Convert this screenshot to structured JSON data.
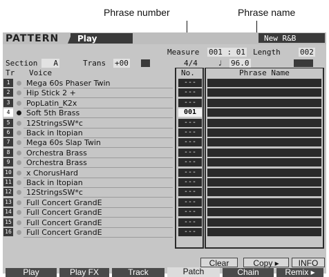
{
  "callouts": {
    "phrase_number": "Phrase number",
    "phrase_name": "Phrase name"
  },
  "header": {
    "mode": "PATTERN",
    "screen": "Play",
    "song_name": "New R&B"
  },
  "measure": {
    "label": "Measure",
    "value": "001 : 01",
    "length_label": "Length",
    "length_value": "002"
  },
  "section_bar": {
    "section_label": "Section",
    "section_value": "A",
    "trans_label": "Trans",
    "trans_value": "+00",
    "meter": "4/4",
    "tempo_symbol": "♩",
    "tempo": "96.0"
  },
  "columns": {
    "track": "Tr",
    "voice": "Voice",
    "number": "No.",
    "phrase_name": "Phrase Name"
  },
  "tracks": [
    {
      "tr": "1",
      "voice": "Mega 60s Phaser Twin",
      "no": "---"
    },
    {
      "tr": "2",
      "voice": "Hip Stick 2 +",
      "no": "---"
    },
    {
      "tr": "3",
      "voice": "PopLatin_K2x",
      "no": "---"
    },
    {
      "tr": "4",
      "voice": "Soft 5th Brass",
      "no": "001"
    },
    {
      "tr": "5",
      "voice": "12StringsSW*c",
      "no": "---"
    },
    {
      "tr": "6",
      "voice": "Back in Itopian",
      "no": "---"
    },
    {
      "tr": "7",
      "voice": "Mega 60s Slap Twin",
      "no": "---"
    },
    {
      "tr": "8",
      "voice": "Orchestra Brass",
      "no": "---"
    },
    {
      "tr": "9",
      "voice": "Orchestra Brass",
      "no": "---"
    },
    {
      "tr": "10",
      "voice": "x ChorusHard",
      "no": "---"
    },
    {
      "tr": "11",
      "voice": "Back in Itopian",
      "no": "---"
    },
    {
      "tr": "12",
      "voice": "12StringsSW*c",
      "no": "---"
    },
    {
      "tr": "13",
      "voice": "Full Concert GrandE",
      "no": "---"
    },
    {
      "tr": "14",
      "voice": "Full Concert GrandE",
      "no": "---"
    },
    {
      "tr": "15",
      "voice": "Full Concert GrandE",
      "no": "---"
    },
    {
      "tr": "16",
      "voice": "Full Concert GrandE",
      "no": "---"
    }
  ],
  "selected_track": "4",
  "buttons": {
    "clear": "Clear",
    "copy": "Copy ▸",
    "info": "INFO"
  },
  "tabs": [
    "Play",
    "Play FX",
    "Track",
    "Patch",
    "Chain",
    "Remix ▸"
  ],
  "active_tab": "Patch"
}
